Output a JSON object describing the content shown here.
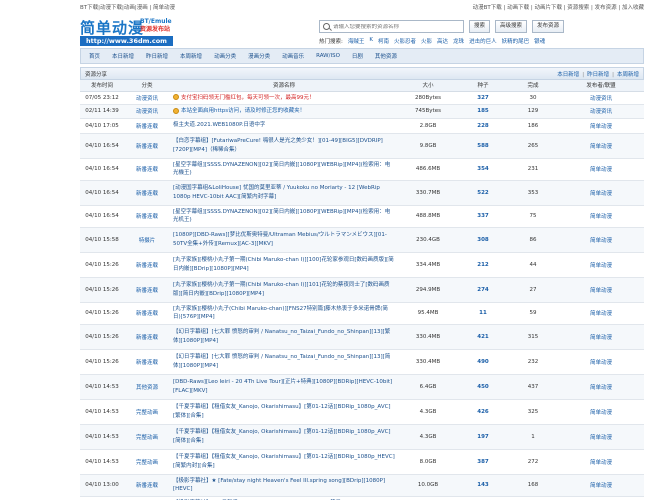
{
  "topbar": {
    "left": "BT下载|动漫下载|动画|漫画 | 简单动漫",
    "right": "动漫BT下载 | 动画下载 | 动画片下载 | 资源搜索 | 发布资源 | 加入收藏"
  },
  "logo": {
    "main": "简单动漫",
    "side1": "BT/Emule",
    "side2": "资源发布站",
    "url": "http://www.36dm.com"
  },
  "search": {
    "placeholder": "请输入您要搜索的资源名称",
    "search_label": "搜索",
    "advanced_label": "高级搜索",
    "publish_label": "发布资源"
  },
  "hot": {
    "label": "热门搜索:",
    "keywords": [
      "海贼王",
      "K",
      "柯南",
      "火影忍者",
      "火影",
      "高达",
      "龙珠",
      "进击的巨人",
      "妖精的尾巴",
      "银魂"
    ]
  },
  "nav": [
    "首页",
    "本日新增",
    "昨日新增",
    "本周新增",
    "动画分类",
    "漫画分类",
    "动画音乐",
    "RAW/ISO",
    "日剧",
    "其他资源"
  ],
  "panel": {
    "title": "资源分享",
    "links": [
      "本日新增",
      "昨日新增",
      "本周新增"
    ]
  },
  "table": {
    "headers": [
      "发布时间",
      "分类",
      "资源名称",
      "大小",
      "种子",
      "完成",
      "发布者/联盟"
    ],
    "rows": [
      {
        "time": "07/05 23:12",
        "cat": "动漫资讯",
        "title": "支付宝扫码领无门槛红包，每天可领一次，最高99元！",
        "size": "280Bytes",
        "seed": "327",
        "done": "30",
        "pub": "动漫资讯",
        "style": "hl",
        "icon": true
      },
      {
        "time": "02/11 14:39",
        "cat": "动漫资讯",
        "title": "本站全面启用https访问，请及时修正您的收藏夹！",
        "size": "745Bytes",
        "seed": "185",
        "done": "129",
        "pub": "动漫资讯",
        "style": "blue",
        "icon": true
      },
      {
        "time": "04/10 17:05",
        "cat": "新番连载",
        "title": "极主夫道.2021.WEB1080P.日语中字",
        "size": "2.8GB",
        "seed": "228",
        "done": "186",
        "pub": "简单动漫",
        "style": "",
        "icon": false
      },
      {
        "time": "04/10 16:54",
        "cat": "新番连载",
        "title": "【白恋字幕组】[FutariwaPreCure! 嗨很人是光之美少女！][01-49][BIG5][DVDRIP][720P][MP4]（稀稀合集）",
        "size": "9.8GB",
        "seed": "588",
        "done": "265",
        "pub": "简单动漫",
        "style": "",
        "icon": false
      },
      {
        "time": "04/10 16:54",
        "cat": "新番连载",
        "title": "[星空字幕组][SSSS.DYNAZENON][02][简日内嵌][1080P][WEBRip][MP4](检索用：电光機王)",
        "size": "486.6MB",
        "seed": "354",
        "done": "231",
        "pub": "简单动漫",
        "style": "",
        "icon": false
      },
      {
        "time": "04/10 16:54",
        "cat": "新番连载",
        "title": "[动漫国字幕组&LoliHouse] 忧国的莫里亚蒂 / Yuukoku no Moriarty - 12 [WebRip 1080p HEVC-10bit AAC][简繁内封字幕]",
        "size": "330.7MB",
        "seed": "522",
        "done": "353",
        "pub": "简单动漫",
        "style": "",
        "icon": false
      },
      {
        "time": "04/10 16:54",
        "cat": "新番连载",
        "title": "[星空字幕组][SSSS.DYNAZENON][02][简日内嵌][1080P][WEBRip][MP4](检索用：电光机王)",
        "size": "488.8MB",
        "seed": "337",
        "done": "75",
        "pub": "简单动漫",
        "style": "",
        "icon": false
      },
      {
        "time": "04/10 15:58",
        "cat": "特摄片",
        "title": "[1080P][DBD-Raws][梦比优斯奥特曼/Ultraman Mebius/ウルトラマンメビウス][01-50TV全集+外传][Remux][AC-3][MKV]",
        "size": "230.4GB",
        "seed": "308",
        "done": "86",
        "pub": "简单动漫",
        "style": "",
        "icon": false
      },
      {
        "time": "04/10 15:26",
        "cat": "新番连载",
        "title": "[丸子家族][樱桃小丸子第一期(Chibi Maruko-chan I)][100]花轮家参观日[数码画质版][简日内嵌][BDrip][1080P][MP4]",
        "size": "334.4MB",
        "seed": "212",
        "done": "44",
        "pub": "简单动漫",
        "style": "",
        "icon": false
      },
      {
        "time": "04/10 15:26",
        "cat": "新番连载",
        "title": "[丸子家族][樱桃小丸子第一期(Chibi Maruko-chan I)][101]花轮的蔡夜同士了[数码画质版][简日内嵌][BDrip][1080P][MP4]",
        "size": "294.9MB",
        "seed": "274",
        "done": "27",
        "pub": "简单动漫",
        "style": "",
        "icon": false
      },
      {
        "time": "04/10 15:26",
        "cat": "新番连载",
        "title": "[丸子家族][樱桃小丸子(Chibi Maruko-chan)][FNS27特别篇]藤木热衷于多米诺骨牌(简日)[576P][MP4]",
        "size": "95.4MB",
        "seed": "11",
        "done": "59",
        "pub": "简单动漫",
        "style": "",
        "icon": false
      },
      {
        "time": "04/10 15:26",
        "cat": "新番连载",
        "title": "【幻日字幕组】[七大罪 愤怒的审判 / Nanatsu_no_Taizai_Fundo_no_Shinpan][13][繁体][1080P][MP4]",
        "size": "330.4MB",
        "seed": "421",
        "done": "315",
        "pub": "简单动漫",
        "style": "",
        "icon": false
      },
      {
        "time": "04/10 15:26",
        "cat": "新番连载",
        "title": "【幻日字幕组】[七大罪 愤怒的审判 / Nanatsu_no_Taizai_Fundo_no_Shinpan][13][简体][1080P][MP4]",
        "size": "330.4MB",
        "seed": "490",
        "done": "232",
        "pub": "简单动漫",
        "style": "",
        "icon": false
      },
      {
        "time": "04/10 14:53",
        "cat": "其他资源",
        "title": "[DBD-Raws][Leo Ieiri - 20 4Th Live Tour][正片+特典][1080P][BDRip][HEVC-10bit][FLAC][MKV]",
        "size": "6.4GB",
        "seed": "450",
        "done": "437",
        "pub": "简单动漫",
        "style": "",
        "icon": false
      },
      {
        "time": "04/10 14:53",
        "cat": "完整动画",
        "title": "【千夏字幕组】【租借女友_Kanojo, Okarishimasu】[第01-12话][BDRip_1080p_AVC][繁体][合集]",
        "size": "4.3GB",
        "seed": "426",
        "done": "325",
        "pub": "简单动漫",
        "style": "",
        "icon": false
      },
      {
        "time": "04/10 14:53",
        "cat": "完整动画",
        "title": "【千夏字幕组】【租借女友_Kanojo, Okarishimasu】[第01-12话][BDRip_1080p_AVC][简体][合集]",
        "size": "4.3GB",
        "seed": "197",
        "done": "1",
        "pub": "简单动漫",
        "style": "",
        "icon": false
      },
      {
        "time": "04/10 14:53",
        "cat": "完整动画",
        "title": "【千夏字幕组】【租借女友_Kanojo, Okarishimasu】[第01-12话][BDRip_1080p_HEVC][简繁内封][合集]",
        "size": "8.0GB",
        "seed": "387",
        "done": "272",
        "pub": "简单动漫",
        "style": "",
        "icon": false
      },
      {
        "time": "04/10 13:00",
        "cat": "新番连载",
        "title": "【极影字幕社】★ [Fate/stay night Heaven's Feel III.spring song][BDrip][1080P][HEVC]",
        "size": "10.0GB",
        "seed": "143",
        "done": "168",
        "pub": "简单动漫",
        "style": "",
        "icon": false
      },
      {
        "time": "04/10 12:36",
        "cat": "新番连载",
        "title": "【极影字幕社】★ 4月新番 [SSSS.DYNAZENON][02][1080P][简日][MP4]",
        "size": "352.4MB",
        "seed": "303",
        "done": "259",
        "pub": "简单动漫",
        "style": "",
        "icon": false
      }
    ]
  }
}
